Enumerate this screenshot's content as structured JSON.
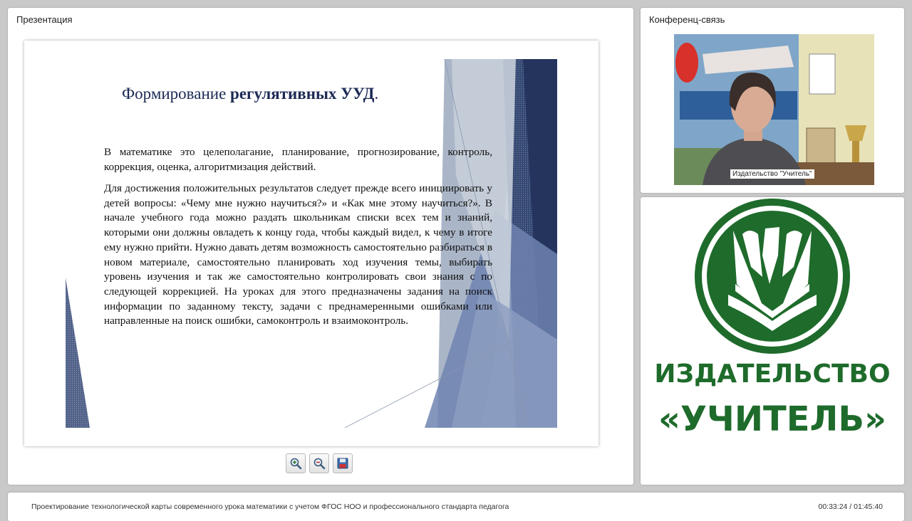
{
  "presentation": {
    "panel_title": "Презентация",
    "slide": {
      "title_prefix": "Формирование ",
      "title_bold": "регулятивных УУД",
      "title_suffix": ".",
      "paragraph1": "В математике это целеполагание, планирование, прогнозирование, контроль, коррекция, оценка, алгоритмизация действий.",
      "paragraph2": "Для достижения положительных результатов следует прежде всего инициировать у детей вопросы: «Чему мне нужно научиться?» и «Как мне этому научиться?». В начале учебного года можно раздать школьникам списки всех тем и знаний, которыми они должны овладеть к концу года, чтобы каждый видел, к чему в итоге ему нужно прийти. Нужно давать детям возможность самостоятельно разбираться в новом материале, самостоятельно планировать ход изучения темы, выбирать уровень изучения и так же самостоятельно контролировать свои знания с по следующей коррекцией. На уроках для этого предназначены задания на поиск информации по заданному тексту, задачи с преднамеренными ошибками или направленные на поиск ошибки, самоконтроль и взаимоконтроль."
    },
    "toolbar": [
      "zoom-in-icon",
      "zoom-out-icon",
      "save-icon"
    ]
  },
  "conference": {
    "panel_title": "Конференц-связь",
    "participant_label": "Издательство \"Учитель\""
  },
  "logo": {
    "line1": "ИЗДАТЕЛЬСТВО",
    "line2": "«УЧИТЕЛЬ»",
    "color": "#1e6b2b"
  },
  "footer": {
    "course_title": "Проектирование технологической карты современного урока математики с учетом ФГОС НОО и профессионального стандарта педагога",
    "timecode": "00:33:24 / 01:45:40"
  }
}
